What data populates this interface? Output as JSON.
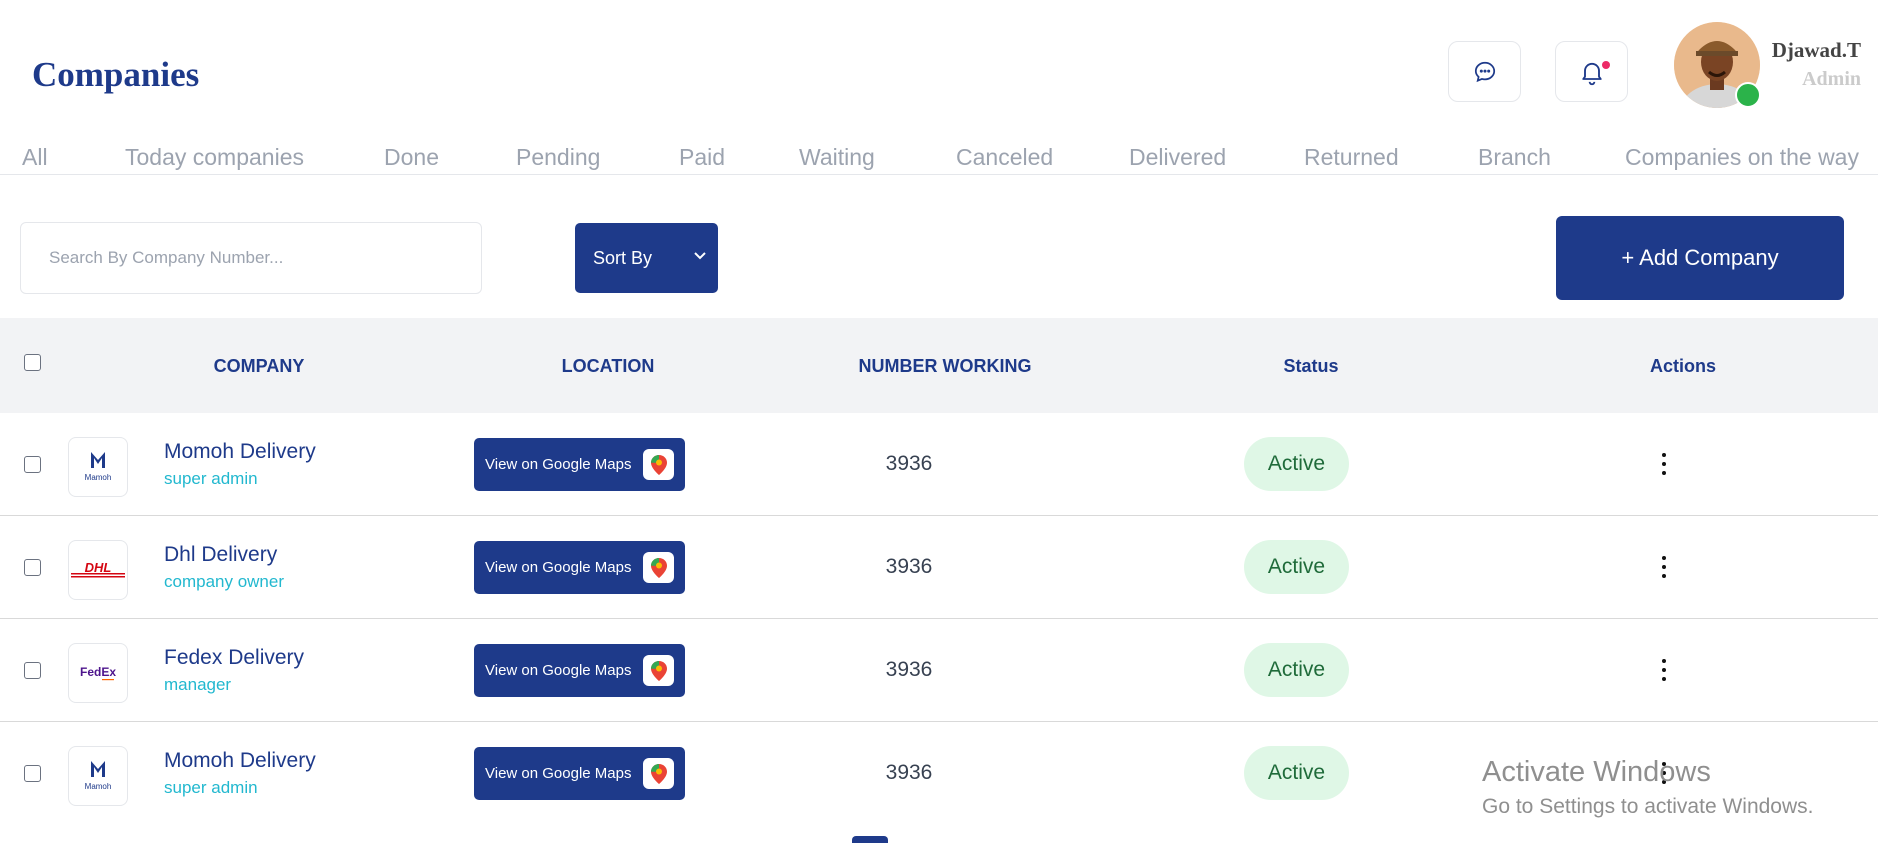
{
  "page": {
    "title": "Companies"
  },
  "header": {
    "chat_icon": "chat-bubble-icon",
    "bell_icon": "bell-icon",
    "user": {
      "name": "Djawad.T",
      "role": "Admin"
    }
  },
  "tabs": [
    "All",
    "Today companies",
    "Done",
    "Pending",
    "Paid",
    "Waiting",
    "Canceled",
    "Delivered",
    "Returned",
    "Branch",
    "Companies on the way"
  ],
  "toolbar": {
    "search_placeholder": "Search By Company Number...",
    "sort_label": "Sort By",
    "add_label": "+ Add Company"
  },
  "table": {
    "columns": [
      "COMPANY",
      "LOCATION",
      "NUMBER WORKING",
      "Status",
      "Actions"
    ],
    "rows": [
      {
        "name": "Momoh Delivery",
        "role": "super admin",
        "logo": "Mamoh",
        "maps_label": "View on Google Maps",
        "number": "3936",
        "status": "Active"
      },
      {
        "name": "Dhl Delivery",
        "role": "company owner",
        "logo": "DHL",
        "maps_label": "View on Google Maps",
        "number": "3936",
        "status": "Active"
      },
      {
        "name": "Fedex Delivery",
        "role": "manager",
        "logo": "FedEx",
        "maps_label": "View on Google Maps",
        "number": "3936",
        "status": "Active"
      },
      {
        "name": "Momoh Delivery",
        "role": "super admin",
        "logo": "Mamoh",
        "maps_label": "View on Google Maps",
        "number": "3936",
        "status": "Active"
      }
    ]
  },
  "watermark": {
    "title": "Activate Windows",
    "subtitle": "Go to Settings to activate Windows."
  },
  "colors": {
    "primary": "#1e3a8a",
    "accent_role": "#22b8cf",
    "status_bg": "#dff7e6",
    "notification": "#ec2a67",
    "online": "#2bb34a"
  }
}
